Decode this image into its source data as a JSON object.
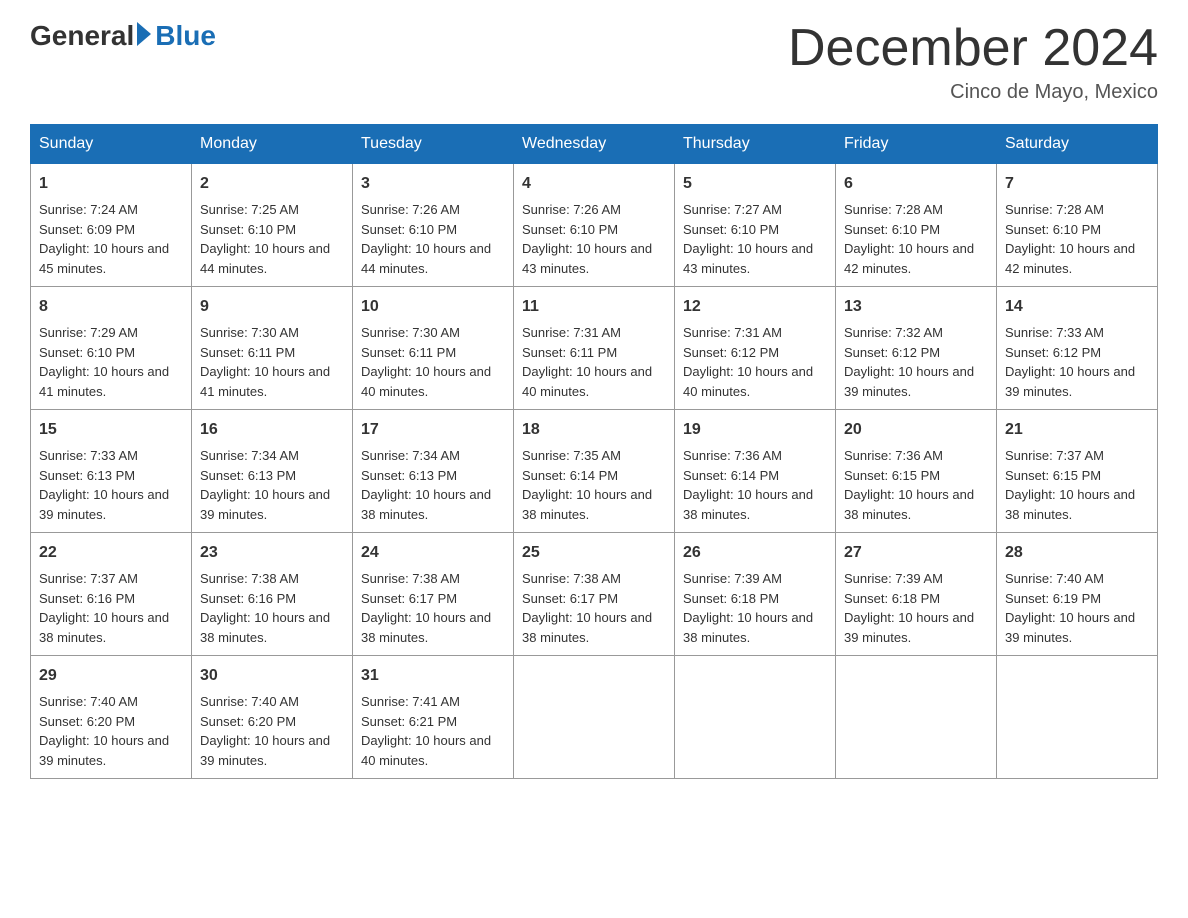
{
  "logo": {
    "general": "General",
    "blue": "Blue"
  },
  "title": "December 2024",
  "subtitle": "Cinco de Mayo, Mexico",
  "days_of_week": [
    "Sunday",
    "Monday",
    "Tuesday",
    "Wednesday",
    "Thursday",
    "Friday",
    "Saturday"
  ],
  "weeks": [
    [
      {
        "day": "1",
        "sunrise": "7:24 AM",
        "sunset": "6:09 PM",
        "daylight": "10 hours and 45 minutes."
      },
      {
        "day": "2",
        "sunrise": "7:25 AM",
        "sunset": "6:10 PM",
        "daylight": "10 hours and 44 minutes."
      },
      {
        "day": "3",
        "sunrise": "7:26 AM",
        "sunset": "6:10 PM",
        "daylight": "10 hours and 44 minutes."
      },
      {
        "day": "4",
        "sunrise": "7:26 AM",
        "sunset": "6:10 PM",
        "daylight": "10 hours and 43 minutes."
      },
      {
        "day": "5",
        "sunrise": "7:27 AM",
        "sunset": "6:10 PM",
        "daylight": "10 hours and 43 minutes."
      },
      {
        "day": "6",
        "sunrise": "7:28 AM",
        "sunset": "6:10 PM",
        "daylight": "10 hours and 42 minutes."
      },
      {
        "day": "7",
        "sunrise": "7:28 AM",
        "sunset": "6:10 PM",
        "daylight": "10 hours and 42 minutes."
      }
    ],
    [
      {
        "day": "8",
        "sunrise": "7:29 AM",
        "sunset": "6:10 PM",
        "daylight": "10 hours and 41 minutes."
      },
      {
        "day": "9",
        "sunrise": "7:30 AM",
        "sunset": "6:11 PM",
        "daylight": "10 hours and 41 minutes."
      },
      {
        "day": "10",
        "sunrise": "7:30 AM",
        "sunset": "6:11 PM",
        "daylight": "10 hours and 40 minutes."
      },
      {
        "day": "11",
        "sunrise": "7:31 AM",
        "sunset": "6:11 PM",
        "daylight": "10 hours and 40 minutes."
      },
      {
        "day": "12",
        "sunrise": "7:31 AM",
        "sunset": "6:12 PM",
        "daylight": "10 hours and 40 minutes."
      },
      {
        "day": "13",
        "sunrise": "7:32 AM",
        "sunset": "6:12 PM",
        "daylight": "10 hours and 39 minutes."
      },
      {
        "day": "14",
        "sunrise": "7:33 AM",
        "sunset": "6:12 PM",
        "daylight": "10 hours and 39 minutes."
      }
    ],
    [
      {
        "day": "15",
        "sunrise": "7:33 AM",
        "sunset": "6:13 PM",
        "daylight": "10 hours and 39 minutes."
      },
      {
        "day": "16",
        "sunrise": "7:34 AM",
        "sunset": "6:13 PM",
        "daylight": "10 hours and 39 minutes."
      },
      {
        "day": "17",
        "sunrise": "7:34 AM",
        "sunset": "6:13 PM",
        "daylight": "10 hours and 38 minutes."
      },
      {
        "day": "18",
        "sunrise": "7:35 AM",
        "sunset": "6:14 PM",
        "daylight": "10 hours and 38 minutes."
      },
      {
        "day": "19",
        "sunrise": "7:36 AM",
        "sunset": "6:14 PM",
        "daylight": "10 hours and 38 minutes."
      },
      {
        "day": "20",
        "sunrise": "7:36 AM",
        "sunset": "6:15 PM",
        "daylight": "10 hours and 38 minutes."
      },
      {
        "day": "21",
        "sunrise": "7:37 AM",
        "sunset": "6:15 PM",
        "daylight": "10 hours and 38 minutes."
      }
    ],
    [
      {
        "day": "22",
        "sunrise": "7:37 AM",
        "sunset": "6:16 PM",
        "daylight": "10 hours and 38 minutes."
      },
      {
        "day": "23",
        "sunrise": "7:38 AM",
        "sunset": "6:16 PM",
        "daylight": "10 hours and 38 minutes."
      },
      {
        "day": "24",
        "sunrise": "7:38 AM",
        "sunset": "6:17 PM",
        "daylight": "10 hours and 38 minutes."
      },
      {
        "day": "25",
        "sunrise": "7:38 AM",
        "sunset": "6:17 PM",
        "daylight": "10 hours and 38 minutes."
      },
      {
        "day": "26",
        "sunrise": "7:39 AM",
        "sunset": "6:18 PM",
        "daylight": "10 hours and 38 minutes."
      },
      {
        "day": "27",
        "sunrise": "7:39 AM",
        "sunset": "6:18 PM",
        "daylight": "10 hours and 39 minutes."
      },
      {
        "day": "28",
        "sunrise": "7:40 AM",
        "sunset": "6:19 PM",
        "daylight": "10 hours and 39 minutes."
      }
    ],
    [
      {
        "day": "29",
        "sunrise": "7:40 AM",
        "sunset": "6:20 PM",
        "daylight": "10 hours and 39 minutes."
      },
      {
        "day": "30",
        "sunrise": "7:40 AM",
        "sunset": "6:20 PM",
        "daylight": "10 hours and 39 minutes."
      },
      {
        "day": "31",
        "sunrise": "7:41 AM",
        "sunset": "6:21 PM",
        "daylight": "10 hours and 40 minutes."
      },
      null,
      null,
      null,
      null
    ]
  ]
}
